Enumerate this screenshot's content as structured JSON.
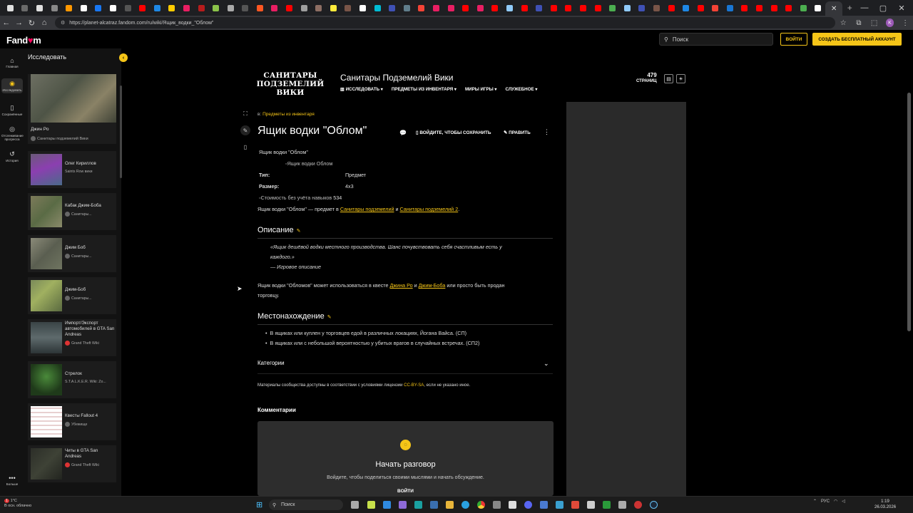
{
  "browser": {
    "url": "https://planet-alcatraz.fandom.com/ru/wiki/Ящик_водки_\"Облом\"",
    "tab_favicon_colors": [
      "#e0e0e0",
      "#6a6a6a",
      "#e0e0e0",
      "#888",
      "#ff9800",
      "#fff",
      "#1877f2",
      "#fff",
      "#555",
      "#ff0000",
      "#1e88e5",
      "#ffcc00",
      "#e91e63",
      "#b71c1c",
      "#8bc34a",
      "#aaa",
      "#555",
      "#ff5722",
      "#e91e63",
      "#ff0000",
      "#9e9e9e",
      "#8d6e63",
      "#ffeb3b",
      "#795548",
      "#fff",
      "#00bcd4",
      "#3f51b5",
      "#607d8b",
      "#f44336",
      "#e91e63",
      "#e91e63",
      "#ff0000",
      "#e91e63",
      "#ff0000",
      "#90caf9",
      "#ff0000",
      "#3f51b5",
      "#ff0000",
      "#ff0000",
      "#ff0000",
      "#ff0000",
      "#4caf50",
      "#90caf9",
      "#3f51b5",
      "#795548",
      "#ff0000",
      "#1e88e5",
      "#ff0000",
      "#f44336",
      "#1976d2",
      "#ff0000",
      "#ff0000",
      "#ff0000",
      "#ff0000",
      "#4caf50",
      "#ffffff"
    ],
    "active_tab_icon": "fandom-icon",
    "new_tab_label": "+",
    "window_controls": [
      "—",
      "▢",
      "✕"
    ],
    "profile_initial": "K"
  },
  "fandom": {
    "logo_prefix": "Fand",
    "logo_heart": "♥",
    "logo_suffix": "m",
    "search_placeholder": "Поиск",
    "login": "ВОЙТИ",
    "signup": "СОЗДАТЬ БЕСПЛАТНЫЙ АККАУНТ",
    "accent_color": "#f5c518"
  },
  "rail": [
    {
      "label": "Главная",
      "icon": "home-icon"
    },
    {
      "label": "Исследовать",
      "icon": "compass-icon"
    },
    {
      "label": "Сохранённые",
      "icon": "bookmark-icon"
    },
    {
      "label": "Отслеживание прогресса",
      "icon": "progress-icon"
    },
    {
      "label": "История",
      "icon": "history-icon"
    },
    {
      "label": "Больше",
      "icon": "more-icon"
    }
  ],
  "explore": {
    "title": "Исследовать",
    "featured": {
      "title": "Джин Ро",
      "source": "Санитары подземелий Вики"
    },
    "cards": [
      {
        "title": "Олег Кириллов",
        "source": "Saints Row вики"
      },
      {
        "title": "Кабак Джим-Боба",
        "source": "Санитары..."
      },
      {
        "title": "Джим Боб",
        "source": "Санитары..."
      },
      {
        "title": "Джим-Боб",
        "source": "Санитары..."
      },
      {
        "title": "Импорт/Экспорт автомобилей в GTA San Andreas",
        "source": "Grand Theft Wiki"
      },
      {
        "title": "Стрелок",
        "source": "S.T.A.L.K.E.R. Wiki: Zo..."
      },
      {
        "title": "Квесты Fallout 4",
        "source": "Убежище"
      },
      {
        "title": "Читы в GTA San Andreas",
        "source": "Grand Theft Wiki"
      }
    ]
  },
  "wiki": {
    "logo_line1": "САНИТАРЫ ПОДЗЕМЕЛИЙ",
    "logo_line2": "ВИКИ",
    "name": "Санитары Подземелий Вики",
    "nav": [
      "ИССЛЕДОВАТЬ",
      "ПРЕДМЕТЫ ИЗ ИНВЕНТАРЯ",
      "МИРЫ ИГРЫ",
      "СЛУЖЕБНОЕ"
    ],
    "nav_explore_icon": "▥",
    "pages_count": "479",
    "pages_label": "СТРАНИЦ"
  },
  "article": {
    "breadcrumb_prefix": "в:",
    "breadcrumb_link": "Предметы из инвентаря",
    "title": "Ящик водки \"Облом\"",
    "save_label": "ВОЙДИТЕ, ЧТОБЫ СОХРАНИТЬ",
    "edit_label": "ПРАВИТЬ",
    "infobox_title": "Ящик водки \"Облом\"",
    "infobox_image_alt": "Ящик водки Облом",
    "type_label": "Тип:",
    "type_value": "Предмет",
    "size_label": "Размер:",
    "size_value": "4x3",
    "cost_image_alt": "Стоимость без учёта навыков",
    "cost_value": "534",
    "intro_pre": "Ящик водки \"Облом\" — предмет в",
    "intro_link1": "Санитары подземелий",
    "intro_and": "и",
    "intro_link2": "Санитары подземелий 2",
    "intro_end": ".",
    "desc_heading": "Описание",
    "quote_line1": "«Ящик дешёвой водки местного производства. Шанс почувствовать себя счастливым есть у",
    "quote_line2": "каждого.»",
    "quote_source": "— Игровое описание",
    "usage_pre": "Ящик водки \"Обломов\" может использоваться в квесте",
    "usage_link1": "Джина Ро",
    "usage_and": "и",
    "usage_link2": "Джим-Боба",
    "usage_post": "или просто быть продан",
    "usage_line2": "торговцу.",
    "loc_heading": "Местонахождение",
    "loc_items": [
      "В ящиках или куплен у торговцев едой в различных локациях, Йогана Вайса. (СП)",
      "В ящиках или с небольшой вероятностью у убитых врагов в случайных встречах. (СП2)"
    ],
    "categories_label": "Категории",
    "license_pre": "Материалы сообщества доступны в соответствии с условиями лицензии",
    "license_link": "CC-BY-SA",
    "license_post": ", если не указано иное.",
    "comments_title": "Комментарии",
    "comments_heading": "Начать разговор",
    "comments_sub": "Войдите, чтобы поделиться своими мыслями и начать обсуждение.",
    "comments_login": "ВОЙТИ"
  },
  "taskbar": {
    "weather_temp": "1°C",
    "weather_desc": "В осн. облачно",
    "weather_badge": "1",
    "search_placeholder": "Поиск",
    "lang": "РУС",
    "time": "1:19",
    "date": "26.03.2026"
  }
}
